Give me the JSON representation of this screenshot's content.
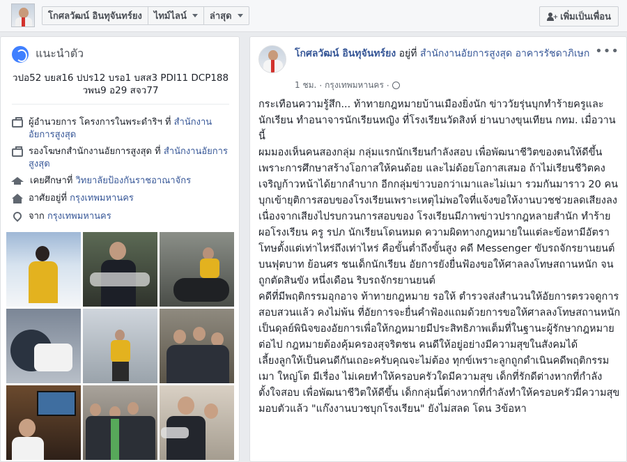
{
  "topbar": {
    "nav": [
      "โกศลวัฒน์ อินทุจันทร์ยง",
      "ไทม์ไลน์",
      "ล่าสุด"
    ],
    "add_friend": "เพิ่มเป็นเพื่อน"
  },
  "intro": {
    "title": "แนะนำตัว",
    "bio": "วปอ52 บยส16 ปปร12 บรอ1 บสส3 PDI11 DCP188 วพน9 อ29 สจว77",
    "items": [
      {
        "icon": "briefcase-icon",
        "text": "ผู้อำนวยการ โครงการในพระดำริฯ ที่",
        "link": "สำนักงานอัยการสูงสุด"
      },
      {
        "icon": "briefcase-icon",
        "text": "รองโฆษกสำนักงานอัยการสูงสุด ที่",
        "link": "สำนักงานอัยการสูงสุด"
      },
      {
        "icon": "graduation-cap-icon",
        "text": "เคยศึกษาที่",
        "link": "วิทยาลัยป้องกันราชอาณาจักร"
      },
      {
        "icon": "home-icon",
        "text": "อาศัยอยู่ที่",
        "link": "กรุงเทพมหานคร"
      },
      {
        "icon": "location-pin-icon",
        "text": "จาก",
        "link": "กรุงเทพมหานคร"
      }
    ]
  },
  "post": {
    "author": "โกศลวัฒน์ อินทุจันทร์ยง",
    "at_text": "อยู่ที่",
    "place": "สำนักงานอัยการสูงสุด อาคารรัชดาภิเษก",
    "time": "1 ชม.",
    "location": "กรุงเทพมหานคร",
    "paragraphs": [
      "กระเทือนความรู้สึก... ท้าทายกฎหมายบ้านเมืองยิ่งนัก ข่าววัยรุ่นบุกทำร้ายครูและนักเรียน ทำอนาจารนักเรียนหญิง ที่โรงเรียนวัดสิงห์ ย่านบางขุนเทียน กทม. เมื่อวานนี้",
      "ผมมองเห็นคนสองกลุ่ม กลุ่มแรกนักเรียนกำลังสอบ เพื่อพัฒนาชีวิตของตนให้ดีขึ้น เพราะการศึกษาสร้างโอกาสให้คนด้อย และไม่ด้อยโอกาสเสมอ ถ้าไม่เรียนชีวิตคงเจริญก้าวหน้าได้ยากลำบาก อีกกลุ่มข่าวบอกว่าเมาและไม่เมา รวมกันมาราว 20 คนบุกเข้ายุติการสอบของโรงเรียนเพราะเหตุไม่พอใจที่แจ้งขอให้งานบวชช่วยลดเสียงลงเนื่องจากเสียงไปรบกวนการสอบของ โรงเรียนมีภาพข่าวปรากฎหลายสำนัก ทำร้ายผอโรงเรียน ครู รปภ นักเรียนโดนหมด ความผิดทางกฎหมายในแต่ละข้อหามีอัตราโทษตั้งแต่เท่าไหร่ถึงเท่าไหร่ คือขั้นต่ำถึงขั้นสูง คดี Messenger ขับรถจักรยานยนต์บนฟุตบาท ย้อนศร ชนเด็กนักเรียน อัยการยังยื่นฟ้องขอให้ศาลลงโทษสถานหนัก จนถูกตัดสินขัง หนึ่งเดือน ริบรถจักรยานยนต์",
      "คดีที่มีพฤติกรรมอุกอาจ ท้าทายกฎหมาย รอให้ ตำรวจส่งสำนวนให้อัยการตรวจดูการสอบสวนแล้ว คงไม่พ้น ที่อัยการจะยื่นคำฟ้องแถมด้วยการขอให้ศาลลงโทษสถานหนัก เป็นดุลย์พินิจของอัยการเพื่อให้กฎหมายมีประสิทธิภาพเต็มที่ในฐานะผู้รักษากฎหมาย ต่อไป กฎหมายต้องคุ้มครองสุจริตชน คนดีให้อยู่อย่างมีความสุขในสังคมได้",
      "เลี้ยงลูกให้เป็นคนดีกันเถอะครับคุณจะไม่ต้อง ทุกข์เพราะลูกถูกดำเนินคดีพฤติกรรม เมา ใหญ่โต มีเรื่อง ไม่เคยทำให้ครอบครัวใดมีความสุข เด็กที่รักดีต่างหากที่กำลังตั้งใจสอบ เพื่อพัฒนาชีวิตให้ดีขึ้น เด็กกลุ่มนี้ต่างหากที่กำลังทำให้ครอบครัวมีความสุข",
      "มอบตัวแล้ว \"แก๊งงานบวชบุกโรงเรียน\" ยังไม่สลด โดน 3ข้อหา"
    ]
  }
}
